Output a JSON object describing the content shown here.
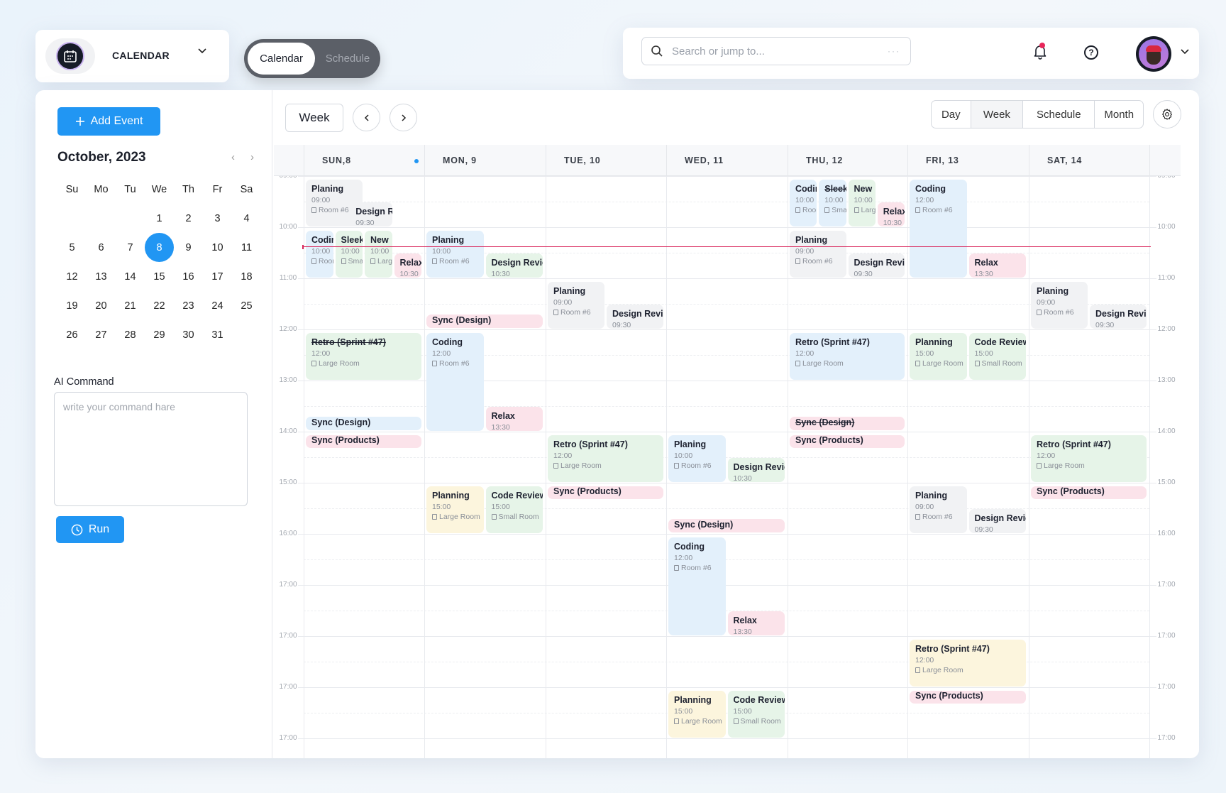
{
  "app": {
    "title": "CALENDAR",
    "logo_icon": "calendar-icon"
  },
  "toggle": {
    "options": [
      "Calendar",
      "Schedule"
    ],
    "active": "Calendar"
  },
  "search": {
    "placeholder": "Search or jump to...",
    "more": "···"
  },
  "header": {
    "notifications_icon": "bell-icon",
    "help_icon": "question-icon",
    "avatar": "user-avatar"
  },
  "sidebar": {
    "add_event": "Add Event",
    "month_title": "October, 2023",
    "weekdays": [
      "Su",
      "Mo",
      "Tu",
      "We",
      "Th",
      "Fr",
      "Sa"
    ],
    "weeks": [
      [
        "",
        "",
        "",
        "1",
        "2",
        "3",
        "4"
      ],
      [
        "5",
        "6",
        "7",
        "8",
        "9",
        "10",
        "11"
      ],
      [
        "12",
        "13",
        "14",
        "15",
        "16",
        "17",
        "18"
      ],
      [
        "19",
        "20",
        "21",
        "22",
        "23",
        "24",
        "25"
      ],
      [
        "26",
        "27",
        "28",
        "29",
        "30",
        "31",
        ""
      ]
    ],
    "selected_day": "8",
    "ai_label": "AI Command",
    "ai_placeholder": "write your command hare",
    "run": "Run"
  },
  "toolbar": {
    "range": "Week",
    "prev": "‹",
    "next": "›",
    "views": [
      "Day",
      "Week",
      "Schedule",
      "Month"
    ],
    "active_view": "Week"
  },
  "days": [
    "SUN,8",
    "MON, 9",
    "TUE, 10",
    "WED, 11",
    "THU, 12",
    "FRI, 13",
    "SAT, 14"
  ],
  "time_labels": [
    "09:00",
    "10:00",
    "11:00",
    "12:00",
    "13:00",
    "14:00",
    "15:00",
    "16:00",
    "17:00",
    "17:00",
    "17:00",
    "17:00"
  ],
  "current_time_row": 1.37,
  "colors": {
    "accent": "#2196f3",
    "now_line": "#d9275d",
    "gray": "#f1f2f4",
    "blue": "#e3f0fb",
    "green": "#e6f4e8",
    "pink": "#fbe3ea",
    "yellow": "#fcf5dd"
  },
  "events": [
    {
      "day": 0,
      "slot": 0,
      "span": 3,
      "start": 0.05,
      "end": 1.0,
      "color": "gray",
      "title": "Planing",
      "time": "09:00",
      "room": "Room #6"
    },
    {
      "day": 0,
      "slot": [
        1.5,
        3
      ],
      "start": 0.5,
      "end": 1.0,
      "color": "gray",
      "title": "Design Revie",
      "time": "09:30"
    },
    {
      "day": 0,
      "slot": [
        0,
        1
      ],
      "start": 1.05,
      "end": 2.0,
      "color": "blue",
      "title": "Codin",
      "time": "10:00",
      "room": "Roor"
    },
    {
      "day": 0,
      "slot": [
        1,
        2
      ],
      "start": 1.05,
      "end": 2.0,
      "color": "green",
      "title": "Sleek",
      "time": "10:00",
      "room": "Sma"
    },
    {
      "day": 0,
      "slot": [
        2,
        3
      ],
      "start": 1.05,
      "end": 2.0,
      "color": "green",
      "title": "New",
      "time": "10:00",
      "room": "Larg"
    },
    {
      "day": 0,
      "slot": [
        3,
        4
      ],
      "start": 1.5,
      "end": 2.0,
      "color": "pink",
      "title": "Relax",
      "time": "10:30"
    },
    {
      "day": 1,
      "slot": [
        0,
        2
      ],
      "start": 1.05,
      "end": 2.0,
      "color": "blue",
      "title": "Planing",
      "time": "10:00",
      "room": "Room #6"
    },
    {
      "day": 1,
      "slot": [
        2,
        4
      ],
      "start": 1.5,
      "end": 2.0,
      "color": "green",
      "title": "Design Revie",
      "time": "10:30"
    },
    {
      "day": 1,
      "slot": [
        0,
        4
      ],
      "start": 2.7,
      "end": 2.98,
      "color": "pink",
      "title": "Sync (Design)",
      "bar": true
    },
    {
      "day": 0,
      "slot": [
        0,
        4
      ],
      "start": 3.05,
      "end": 4.0,
      "color": "green",
      "title": "Retro (Sprint #47)",
      "time": "12:00",
      "room": "Large Room",
      "strike": true
    },
    {
      "day": 1,
      "slot": [
        0,
        2
      ],
      "start": 3.05,
      "end": 5.0,
      "color": "blue",
      "title": "Coding",
      "time": "12:00",
      "room": "Room #6"
    },
    {
      "day": 1,
      "slot": [
        2,
        4
      ],
      "start": 4.5,
      "end": 5.0,
      "color": "pink",
      "title": "Relax",
      "time": "13:30"
    },
    {
      "day": 0,
      "slot": [
        0,
        4
      ],
      "start": 4.7,
      "end": 4.98,
      "color": "blue",
      "title": "Sync (Design)",
      "bar": true
    },
    {
      "day": 0,
      "slot": [
        0,
        4
      ],
      "start": 5.05,
      "end": 5.33,
      "color": "pink",
      "title": "Sync (Products)",
      "bar": true
    },
    {
      "day": 2,
      "slot": [
        0,
        2
      ],
      "start": 2.05,
      "end": 3.0,
      "color": "gray",
      "title": "Planing",
      "time": "09:00",
      "room": "Room #6"
    },
    {
      "day": 2,
      "slot": [
        2,
        4
      ],
      "start": 2.5,
      "end": 3.0,
      "color": "gray",
      "title": "Design Revie",
      "time": "09:30"
    },
    {
      "day": 2,
      "slot": [
        0,
        4
      ],
      "start": 5.05,
      "end": 6.0,
      "color": "green",
      "title": "Retro (Sprint #47)",
      "time": "12:00",
      "room": "Large Room"
    },
    {
      "day": 2,
      "slot": [
        0,
        4
      ],
      "start": 6.05,
      "end": 6.33,
      "color": "pink",
      "title": "Sync (Products)",
      "bar": true
    },
    {
      "day": 1,
      "slot": [
        0,
        2
      ],
      "start": 6.05,
      "end": 7.0,
      "color": "yellow",
      "title": "Planning",
      "time": "15:00",
      "room": "Large Room"
    },
    {
      "day": 1,
      "slot": [
        2,
        4
      ],
      "start": 6.05,
      "end": 7.0,
      "color": "green",
      "title": "Code Review",
      "time": "15:00",
      "room": "Small Room"
    },
    {
      "day": 3,
      "slot": [
        0,
        2
      ],
      "start": 5.05,
      "end": 6.0,
      "color": "blue",
      "title": "Planing",
      "time": "10:00",
      "room": "Room #6"
    },
    {
      "day": 3,
      "slot": [
        2,
        4
      ],
      "start": 5.5,
      "end": 6.0,
      "color": "green",
      "title": "Design Revie",
      "time": "10:30"
    },
    {
      "day": 3,
      "slot": [
        0,
        4
      ],
      "start": 6.7,
      "end": 6.98,
      "color": "pink",
      "title": "Sync (Design)",
      "bar": true
    },
    {
      "day": 3,
      "slot": [
        0,
        2
      ],
      "start": 7.05,
      "end": 9.0,
      "color": "blue",
      "title": "Coding",
      "time": "12:00",
      "room": "Room #6"
    },
    {
      "day": 3,
      "slot": [
        2,
        4
      ],
      "start": 8.5,
      "end": 9.0,
      "color": "pink",
      "title": "Relax",
      "time": "13:30"
    },
    {
      "day": 3,
      "slot": [
        0,
        2
      ],
      "start": 10.05,
      "end": 11.0,
      "color": "yellow",
      "title": "Planning",
      "time": "15:00",
      "room": "Large Room"
    },
    {
      "day": 3,
      "slot": [
        2,
        4
      ],
      "start": 10.05,
      "end": 11.0,
      "color": "green",
      "title": "Code Review",
      "time": "15:00",
      "room": "Small Room"
    },
    {
      "day": 4,
      "slot": [
        0,
        1
      ],
      "start": 0.05,
      "end": 1.0,
      "color": "blue",
      "title": "Codin",
      "time": "10:00",
      "room": "Roor"
    },
    {
      "day": 4,
      "slot": [
        1,
        2
      ],
      "start": 0.05,
      "end": 1.0,
      "color": "blue",
      "title": "Sleek",
      "time": "10:00",
      "room": "Sma",
      "strike": true
    },
    {
      "day": 4,
      "slot": [
        2,
        3
      ],
      "start": 0.05,
      "end": 1.0,
      "color": "green",
      "title": "New",
      "time": "10:00",
      "room": "Larg"
    },
    {
      "day": 4,
      "slot": [
        3,
        4
      ],
      "start": 0.5,
      "end": 1.0,
      "color": "pink",
      "title": "Relax",
      "time": "10:30"
    },
    {
      "day": 4,
      "slot": [
        0,
        2
      ],
      "start": 1.05,
      "end": 2.0,
      "color": "gray",
      "title": "Planing",
      "time": "09:00",
      "room": "Room #6"
    },
    {
      "day": 4,
      "slot": [
        2,
        4
      ],
      "start": 1.5,
      "end": 2.0,
      "color": "gray",
      "title": "Design Revie",
      "time": "09:30"
    },
    {
      "day": 4,
      "slot": [
        0,
        4
      ],
      "start": 3.05,
      "end": 4.0,
      "color": "blue",
      "title": "Retro (Sprint #47)",
      "time": "12:00",
      "room": "Large Room"
    },
    {
      "day": 4,
      "slot": [
        0,
        4
      ],
      "start": 4.7,
      "end": 4.98,
      "color": "pink",
      "title": "Sync (Design)",
      "bar": true,
      "strike": true
    },
    {
      "day": 4,
      "slot": [
        0,
        4
      ],
      "start": 5.05,
      "end": 5.33,
      "color": "pink",
      "title": "Sync (Products)",
      "bar": true
    },
    {
      "day": 5,
      "slot": [
        0,
        2
      ],
      "start": 0.05,
      "end": 2.0,
      "color": "blue",
      "title": "Coding",
      "time": "12:00",
      "room": "Room #6"
    },
    {
      "day": 5,
      "slot": [
        2,
        4
      ],
      "start": 1.5,
      "end": 2.0,
      "color": "pink",
      "title": "Relax",
      "time": "13:30"
    },
    {
      "day": 5,
      "slot": [
        0,
        2
      ],
      "start": 3.05,
      "end": 4.0,
      "color": "green",
      "title": "Planning",
      "time": "15:00",
      "room": "Large Room"
    },
    {
      "day": 5,
      "slot": [
        2,
        4
      ],
      "start": 3.05,
      "end": 4.0,
      "color": "green",
      "title": "Code Review",
      "time": "15:00",
      "room": "Small Room"
    },
    {
      "day": 5,
      "slot": [
        0,
        2
      ],
      "start": 6.05,
      "end": 7.0,
      "color": "gray",
      "title": "Planing",
      "time": "09:00",
      "room": "Room #6"
    },
    {
      "day": 5,
      "slot": [
        2,
        4
      ],
      "start": 6.5,
      "end": 7.0,
      "color": "gray",
      "title": "Design Revie",
      "time": "09:30"
    },
    {
      "day": 5,
      "slot": [
        0,
        4
      ],
      "start": 9.05,
      "end": 10.0,
      "color": "yellow",
      "title": "Retro (Sprint #47)",
      "time": "12:00",
      "room": "Large Room"
    },
    {
      "day": 5,
      "slot": [
        0,
        4
      ],
      "start": 10.05,
      "end": 10.33,
      "color": "pink",
      "title": "Sync (Products)",
      "bar": true
    },
    {
      "day": 6,
      "slot": [
        0,
        2
      ],
      "start": 2.05,
      "end": 3.0,
      "color": "gray",
      "title": "Planing",
      "time": "09:00",
      "room": "Room #6"
    },
    {
      "day": 6,
      "slot": [
        2,
        4
      ],
      "start": 2.5,
      "end": 3.0,
      "color": "gray",
      "title": "Design Revie",
      "time": "09:30"
    },
    {
      "day": 6,
      "slot": [
        0,
        4
      ],
      "start": 5.05,
      "end": 6.0,
      "color": "green",
      "title": "Retro (Sprint #47)",
      "time": "12:00",
      "room": "Large Room"
    },
    {
      "day": 6,
      "slot": [
        0,
        4
      ],
      "start": 6.05,
      "end": 6.33,
      "color": "pink",
      "title": "Sync (Products)",
      "bar": true
    }
  ]
}
